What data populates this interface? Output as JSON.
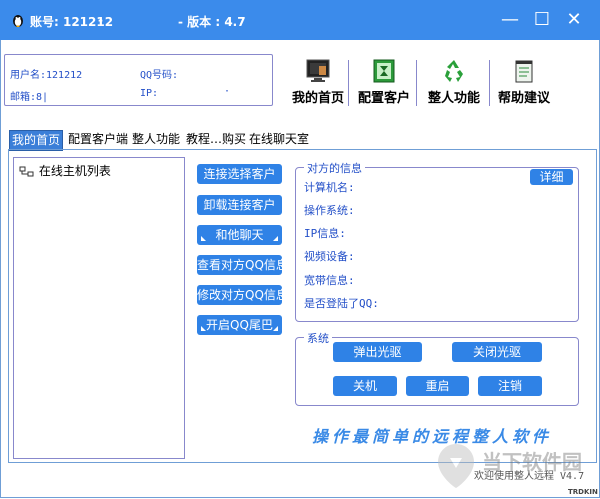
{
  "window": {
    "account_label": "账号: 121212",
    "dash": "-",
    "version_label": "- 版本 : 4.7",
    "controls": {
      "minimize": "—",
      "maximize": "☐",
      "close": "✕"
    }
  },
  "account_info": {
    "username_label": "用户名:121212",
    "qq_label": "QQ号码:",
    "email_label": "邮箱:8|",
    "ip_label": "IP:",
    "ip_dots": "·"
  },
  "toolbar": {
    "items": [
      {
        "label": "我的首页",
        "icon": "monitor-icon"
      },
      {
        "label": "配置客户",
        "icon": "config-icon"
      },
      {
        "label": "整人功能",
        "icon": "recycle-icon"
      },
      {
        "label": "帮助建议",
        "icon": "notepad-icon"
      }
    ]
  },
  "tabs": [
    {
      "label": "我的首页",
      "active": true
    },
    {
      "label": "配置客户端",
      "active": false
    },
    {
      "label": "整人功能",
      "active": false
    },
    {
      "label": "教程…购买",
      "active": false
    },
    {
      "label": "在线聊天室",
      "active": false
    }
  ],
  "tree": {
    "root_label": "在线主机列表"
  },
  "actions": {
    "connect": "连接选择客户",
    "disconnect": "卸载连接客户",
    "chat": "和他聊天",
    "view_qq": "查看对方QQ信息",
    "modify_qq": "修改对方QQ信息",
    "qq_tail": "开启QQ尾巴"
  },
  "peer_info": {
    "legend": "对方的信息",
    "detail_button": "详细",
    "fields": {
      "computer": "计算机名:",
      "os": "操作系统:",
      "ip": "IP信息:",
      "video": "视频设备:",
      "bandwidth": "宽带信息:",
      "qq_login": "是否登陆了QQ:"
    }
  },
  "system": {
    "legend": "系统",
    "eject": "弹出光驱",
    "close_cd": "关闭光驱",
    "shutdown": "关机",
    "restart": "重启",
    "logoff": "注销"
  },
  "footer": {
    "slogan": "操作最简单的远程整人软件",
    "welcome": "欢迎使用整人远程 V4.7",
    "brand": "TRDKIN",
    "watermark": "当下软件园"
  },
  "colors": {
    "titlebar": "#3b8beb",
    "button": "#2f82e6",
    "label": "#2450c8"
  }
}
